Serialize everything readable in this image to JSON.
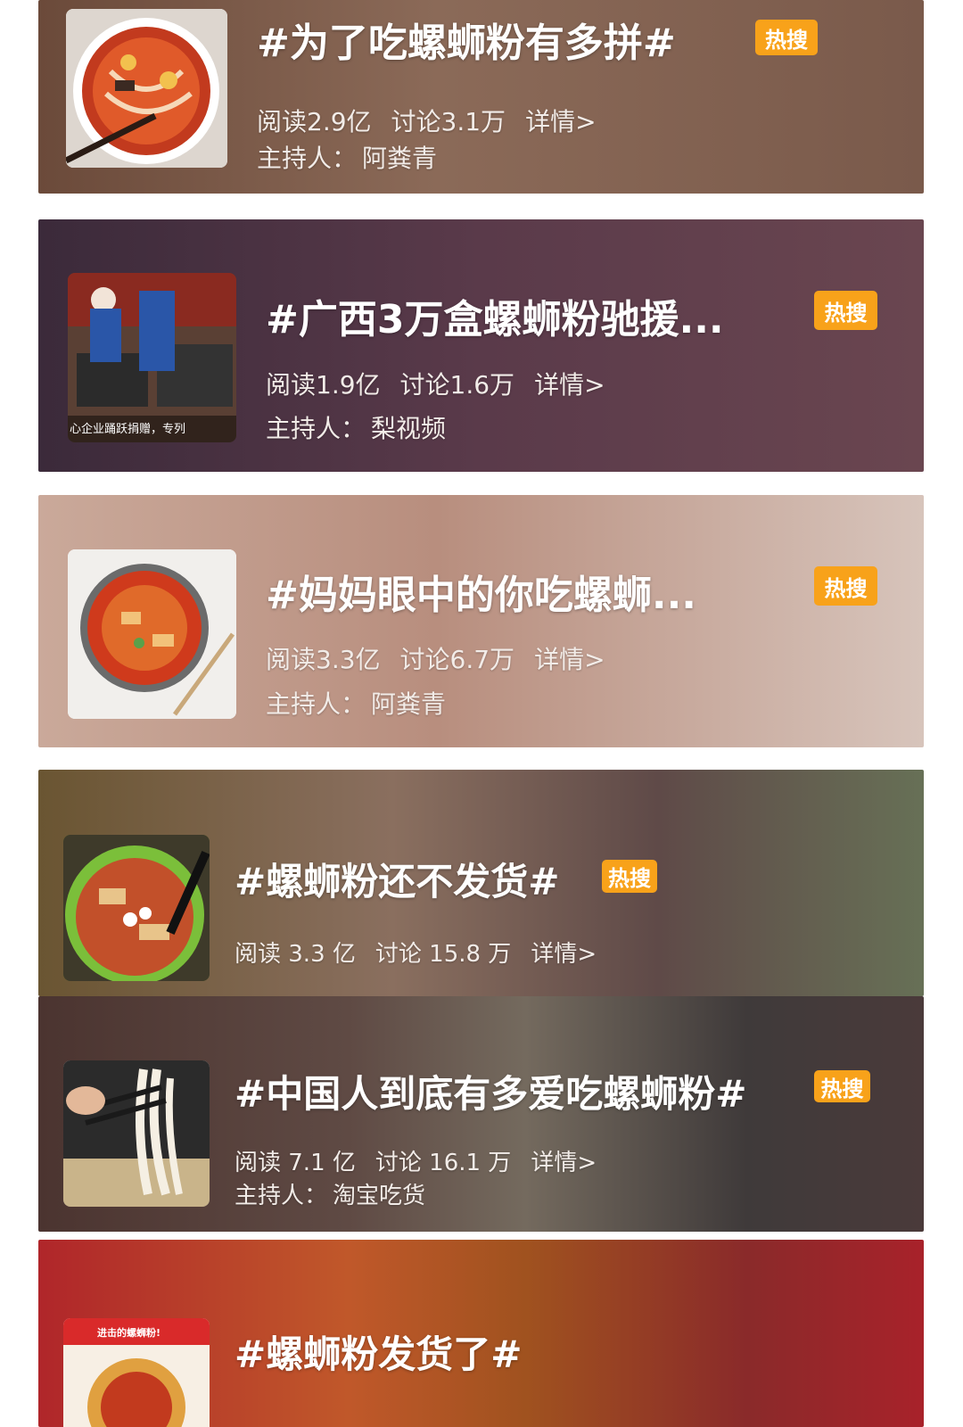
{
  "accent": {
    "hot_badge": "#f8a21a"
  },
  "topics": [
    {
      "title": "#为了吃螺蛳粉有多拼#",
      "badge": "热搜",
      "read_label": "阅读2.9亿",
      "discuss_label": "讨论3.1万",
      "detail_label": "详情>",
      "host_label": "主持人：",
      "host_name": "阿粪青",
      "thumb_icon": "noodle-bowl-image"
    },
    {
      "title": "#广西3万盒螺蛳粉驰援...",
      "badge": "热搜",
      "read_label": "阅读1.9亿",
      "discuss_label": "讨论1.6万",
      "detail_label": "详情>",
      "host_label": "主持人：",
      "host_name": "梨视频",
      "thumb_icon": "workers-crates-image",
      "thumb_caption": "心企业踊跃捐赠，专列"
    },
    {
      "title": "#妈妈眼中的你吃螺蛳...",
      "badge": "热搜",
      "read_label": "阅读3.3亿",
      "discuss_label": "讨论6.7万",
      "detail_label": "详情>",
      "host_label": "主持人：",
      "host_name": "阿粪青",
      "thumb_icon": "noodle-bowl-image"
    },
    {
      "title": "#螺蛳粉还不发货#",
      "badge": "热搜",
      "read_label": "阅读 3.3 亿",
      "discuss_label": "讨论 15.8 万",
      "detail_label": "详情>",
      "thumb_icon": "noodle-plate-image"
    },
    {
      "title": "#中国人到底有多爱吃螺蛳粉#",
      "badge": "热搜",
      "read_label": "阅读 7.1 亿",
      "discuss_label": "讨论 16.1 万",
      "detail_label": "详情>",
      "host_label": "主持人：",
      "host_name": "淘宝吃货",
      "thumb_icon": "chopsticks-noodles-image"
    },
    {
      "title": "#螺蛳粉发货了#",
      "thumb_icon": "poster-image",
      "thumb_caption": "进击的螺蛳粉!"
    }
  ]
}
